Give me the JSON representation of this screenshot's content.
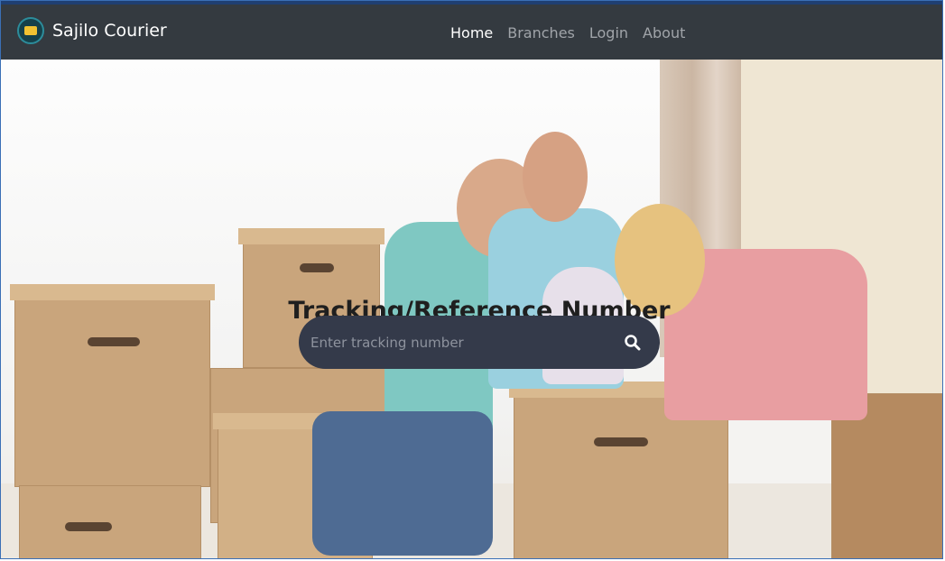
{
  "window": {
    "accent_color": "#3a6fb6",
    "strip_color": "#1f3f72"
  },
  "navbar": {
    "brand": {
      "name": "Sajilo Courier",
      "logo_icon": "courier-logo-icon"
    },
    "links": [
      {
        "label": "Home",
        "active": true
      },
      {
        "label": "Branches",
        "active": false
      },
      {
        "label": "Login",
        "active": false
      },
      {
        "label": "About",
        "active": false
      }
    ],
    "background_color": "#343a40"
  },
  "hero": {
    "title": "Tracking/Reference Number",
    "search": {
      "placeholder": "Enter tracking number",
      "value": "",
      "icon": "search-icon",
      "background_color": "#343a4a"
    }
  }
}
